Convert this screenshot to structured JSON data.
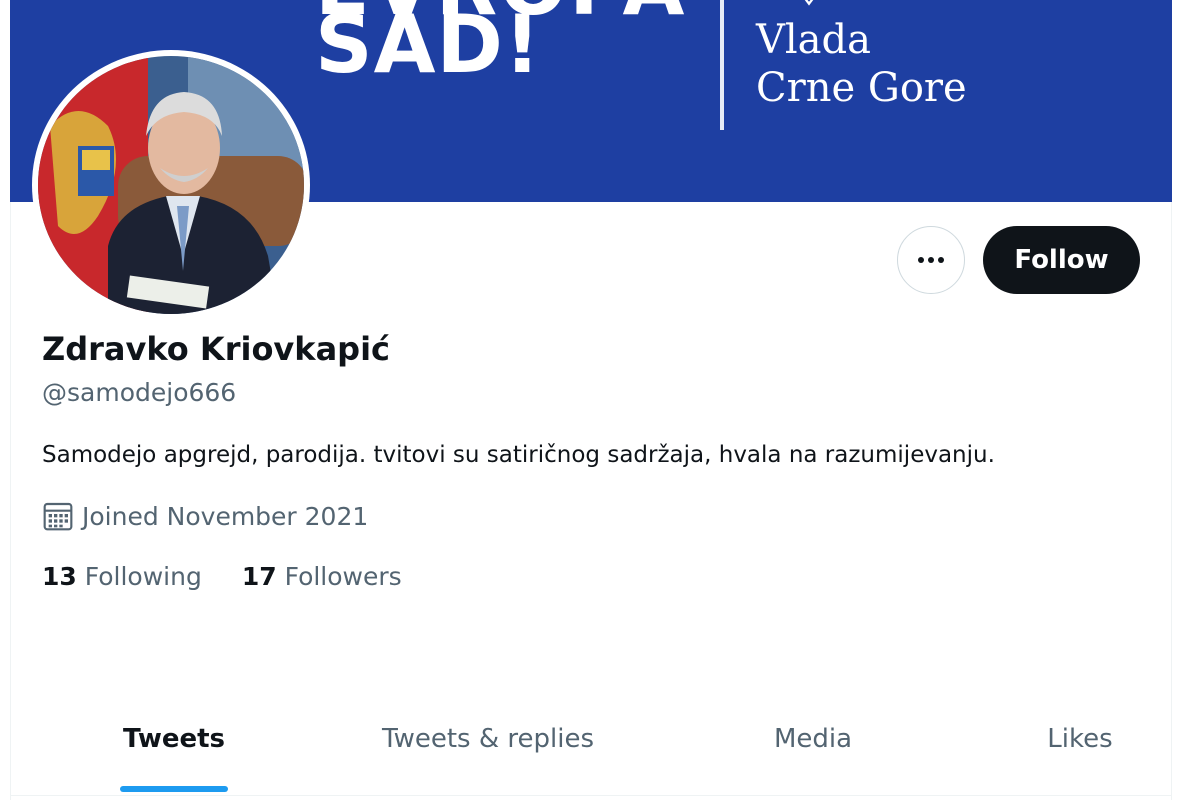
{
  "banner": {
    "headline_top": "EVROPA",
    "headline": "SAD!",
    "org_line1": "Vlada",
    "org_line2": "Crne Gore",
    "background_color": "#1e3fa2"
  },
  "profile": {
    "display_name": "Zdravko Kriovkapić",
    "handle": "@samodejo666",
    "bio": "Samodejo apgrejd, parodija. tvitovi su satiričnog sadržaja, hvala na razumijevanju.",
    "joined": "Joined November 2021",
    "following_count": "13",
    "following_label": "Following",
    "followers_count": "17",
    "followers_label": "Followers"
  },
  "actions": {
    "more_icon": "more-horizontal-icon",
    "follow_label": "Follow"
  },
  "tabs": [
    {
      "label": "Tweets",
      "active": true
    },
    {
      "label": "Tweets & replies",
      "active": false
    },
    {
      "label": "Media",
      "active": false
    },
    {
      "label": "Likes",
      "active": false
    }
  ],
  "colors": {
    "accent": "#1d9bf0",
    "text_primary": "#0f1419",
    "text_secondary": "#536471",
    "button_dark": "#0f1419"
  }
}
